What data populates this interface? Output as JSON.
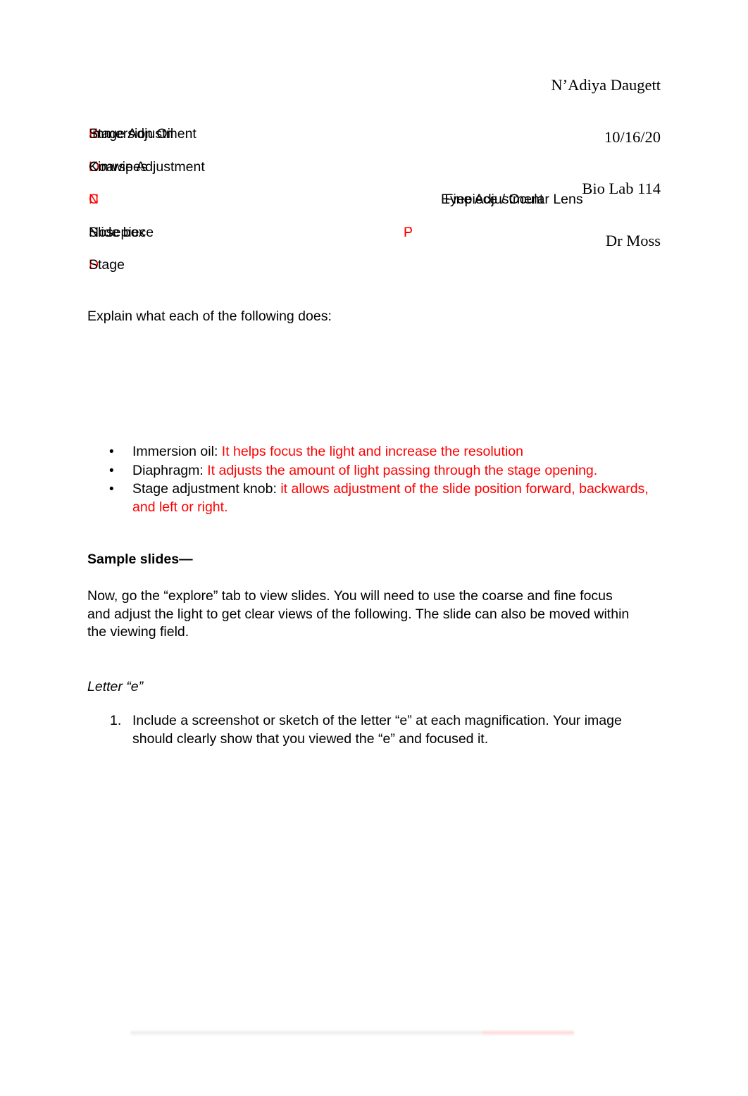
{
  "header": {
    "lines": [
      "N’Adiya Daugett",
      "10/16/20",
      "Bio Lab 114",
      "Dr Moss"
    ],
    "student_name": "N’Adiya Daugett",
    "date": "10/16/20",
    "course": "Bio Lab 114",
    "instructor": "Dr Moss"
  },
  "colors": {
    "answer_red": "#FF0000",
    "body_black": "#000000",
    "page_background": "#FFFFFF"
  },
  "key_list": {
    "rows": [
      {
        "left": {
          "letter": "B",
          "label": "Immersion Oil"
        },
        "right": {
          "letter": "E",
          "label": "Stage Adjustment"
        }
      },
      {
        "left": {
          "letter": "O",
          "label": "Kimwipes"
        },
        "right": {
          "letter": "L",
          "label": "Coarse Adjustment"
        }
      },
      {
        "left": {
          "letter": "C",
          "label": "Eyepiece / Ocular Lens"
        },
        "right": {
          "letter": "N",
          "label": " Fine Adjustment"
        }
      },
      {
        "left": {
          "letter": "F",
          "label": "Nosepiece"
        },
        "right": {
          "letter": "P",
          "label": "Slide box"
        }
      },
      {
        "left": {
          "letter": "D",
          "label": "Stage"
        },
        "right": {
          "letter": "",
          "label": ""
        }
      }
    ]
  },
  "explain_prompt": "Explain what each of the following does:",
  "bullets": {
    "marker": "•",
    "items": [
      {
        "term": "Immersion oil: ",
        "answer": "It helps focus the light and increase the resolution"
      },
      {
        "term": "Diaphragm: ",
        "answer": "It adjusts the amount of light passing through the stage opening."
      },
      {
        "term": "Stage adjustment knob: ",
        "answer": "it allows adjustment of the slide position forward, backwards, and left or right."
      }
    ]
  },
  "sample_slides": {
    "heading": "Sample slides—",
    "instructions": "Now, go the “explore” tab to view slides. You will need to use the coarse and fine focus and adjust the light to get clear views of the following. The slide can also be moved within the viewing field."
  },
  "letter_e": {
    "heading": "Letter “e”",
    "items": [
      {
        "number": "1.",
        "text": "Include a screenshot or sketch of the letter “e” at each magnification. Your image should clearly show that you viewed the “e” and focused it."
      }
    ]
  }
}
